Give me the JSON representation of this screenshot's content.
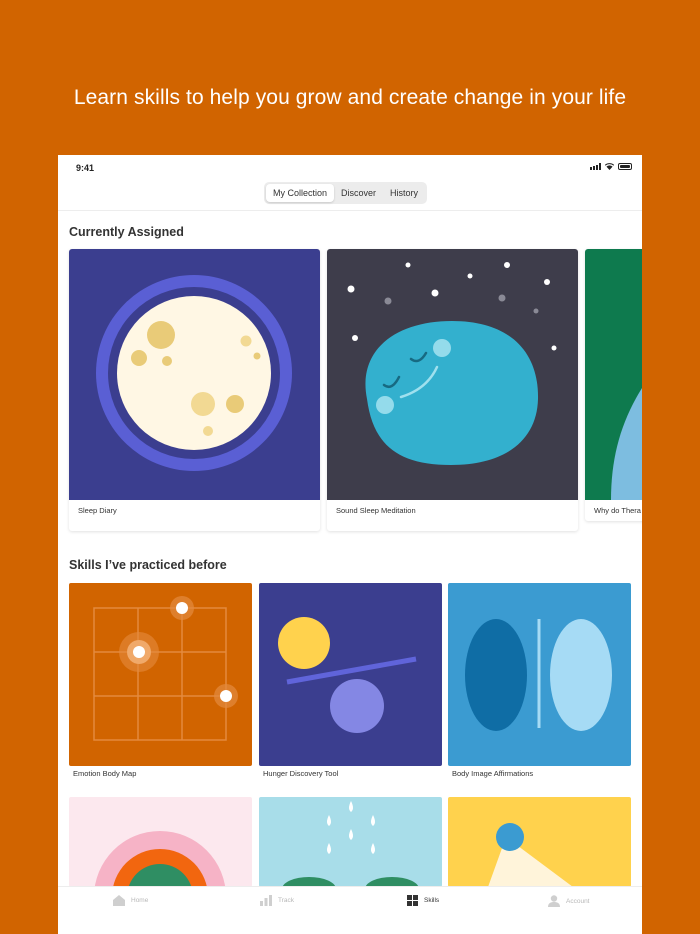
{
  "headline": "Learn skills to help you grow and create change in your life",
  "status": {
    "time": "9:41"
  },
  "segments": [
    {
      "label": "My Collection",
      "active": true
    },
    {
      "label": "Discover",
      "active": false
    },
    {
      "label": "History",
      "active": false
    }
  ],
  "assigned": {
    "title": "Currently Assigned",
    "cards": [
      {
        "label": "Sleep Diary"
      },
      {
        "label": "Sound Sleep Meditation"
      },
      {
        "label": "Why do Thera"
      }
    ]
  },
  "practiced": {
    "title": "Skills I’ve practiced before",
    "items": [
      {
        "label": "Emotion Body Map"
      },
      {
        "label": "Hunger Discovery Tool"
      },
      {
        "label": "Body Image Affirmations"
      }
    ]
  },
  "tabbar": {
    "items": [
      {
        "label": "Home",
        "icon": "home-icon",
        "active": false
      },
      {
        "label": "Track",
        "icon": "chart-icon",
        "active": false
      },
      {
        "label": "Skills",
        "icon": "grid-icon",
        "active": true
      },
      {
        "label": "Account",
        "icon": "person-icon",
        "active": false
      }
    ]
  },
  "colors": {
    "background": "#D16400",
    "accent": "#3B3E8F",
    "active_tab": "#333333",
    "inactive_tab": "#B8B8B8"
  }
}
